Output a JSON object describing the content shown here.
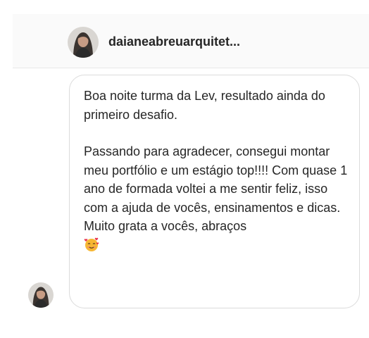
{
  "header": {
    "username": "daianeabreuarquitet..."
  },
  "message": {
    "paragraph1": "Boa noite turma da Lev, resultado ainda do primeiro desafio.",
    "paragraph2": "Passando para agradecer, consegui montar meu portfólio e um estágio top!!!! Com quase 1 ano de formada voltei a me sentir feliz, isso com a ajuda de vocês, ensinamentos e dicas. Muito grata a vocês, abraços",
    "emoji": "smiling-face-with-hearts-icon"
  },
  "colors": {
    "header_bg": "#fafafa",
    "bubble_border": "#dbdbdb",
    "text": "#262626"
  }
}
